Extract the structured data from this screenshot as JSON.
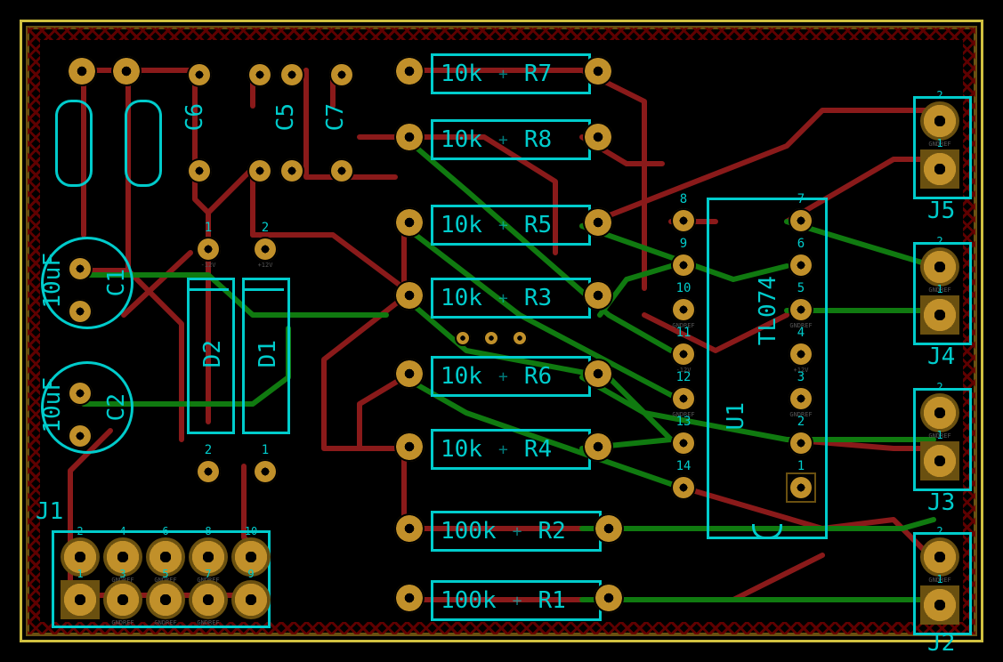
{
  "components": {
    "C1": {
      "ref": "C1",
      "value": "10uF"
    },
    "C2": {
      "ref": "C2",
      "value": "10uF"
    },
    "C5": {
      "ref": "C5"
    },
    "C6": {
      "ref": "C6"
    },
    "C7": {
      "ref": "C7"
    },
    "D1": {
      "ref": "D1"
    },
    "D2": {
      "ref": "D2"
    },
    "U1": {
      "ref": "U1",
      "value": "TL074"
    },
    "R1": {
      "ref": "R1",
      "value": "100k"
    },
    "R2": {
      "ref": "R2",
      "value": "100k"
    },
    "R3": {
      "ref": "R3",
      "value": "10k"
    },
    "R4": {
      "ref": "R4",
      "value": "10k"
    },
    "R5": {
      "ref": "R5",
      "value": "10k"
    },
    "R6": {
      "ref": "R6",
      "value": "10k"
    },
    "R7": {
      "ref": "R7",
      "value": "10k"
    },
    "R8": {
      "ref": "R8",
      "value": "10k"
    },
    "J1": {
      "ref": "J1"
    },
    "J2": {
      "ref": "J2"
    },
    "J3": {
      "ref": "J3"
    },
    "J4": {
      "ref": "J4"
    },
    "J5": {
      "ref": "J5"
    }
  },
  "ic_pins": {
    "p1": {
      "num": "1",
      "net": ""
    },
    "p2": {
      "num": "2",
      "net": ""
    },
    "p3": {
      "num": "3",
      "net": "GNDREF"
    },
    "p4": {
      "num": "4",
      "net": "+12V"
    },
    "p5": {
      "num": "5",
      "net": "GNDREF"
    },
    "p6": {
      "num": "6",
      "net": ""
    },
    "p7": {
      "num": "7",
      "net": ""
    },
    "p8": {
      "num": "8",
      "net": ""
    },
    "p9": {
      "num": "9",
      "net": ""
    },
    "p10": {
      "num": "10",
      "net": "GNDREF"
    },
    "p11": {
      "num": "11",
      "net": "-12V"
    },
    "p12": {
      "num": "12",
      "net": "GNDREF"
    },
    "p13": {
      "num": "13",
      "net": ""
    },
    "p14": {
      "num": "14",
      "net": ""
    }
  },
  "power_hdr": {
    "p1": {
      "num": "1",
      "net": "-12V"
    },
    "p2": {
      "num": "2",
      "net": "+12V"
    }
  },
  "aux_hdr": {
    "p1": {
      "num": "1",
      "net": ""
    },
    "p2": {
      "num": "2",
      "net": ""
    }
  },
  "j1_pins": {
    "p1": {
      "num": "1",
      "net": ""
    },
    "p2": {
      "num": "2",
      "net": ""
    },
    "p3": {
      "num": "3",
      "net": "GNDREF"
    },
    "p4": {
      "num": "4",
      "net": "GNDREF"
    },
    "p5": {
      "num": "5",
      "net": "GNDREF"
    },
    "p6": {
      "num": "6",
      "net": "GNDREF"
    },
    "p7": {
      "num": "7",
      "net": "GNDREF"
    },
    "p8": {
      "num": "8",
      "net": "GNDREF"
    },
    "p9": {
      "num": "9",
      "net": ""
    },
    "p10": {
      "num": "10",
      "net": ""
    }
  },
  "jside": {
    "p1": {
      "num": "1",
      "net": ""
    },
    "p2": {
      "num": "2",
      "net": "GNDREF"
    }
  }
}
